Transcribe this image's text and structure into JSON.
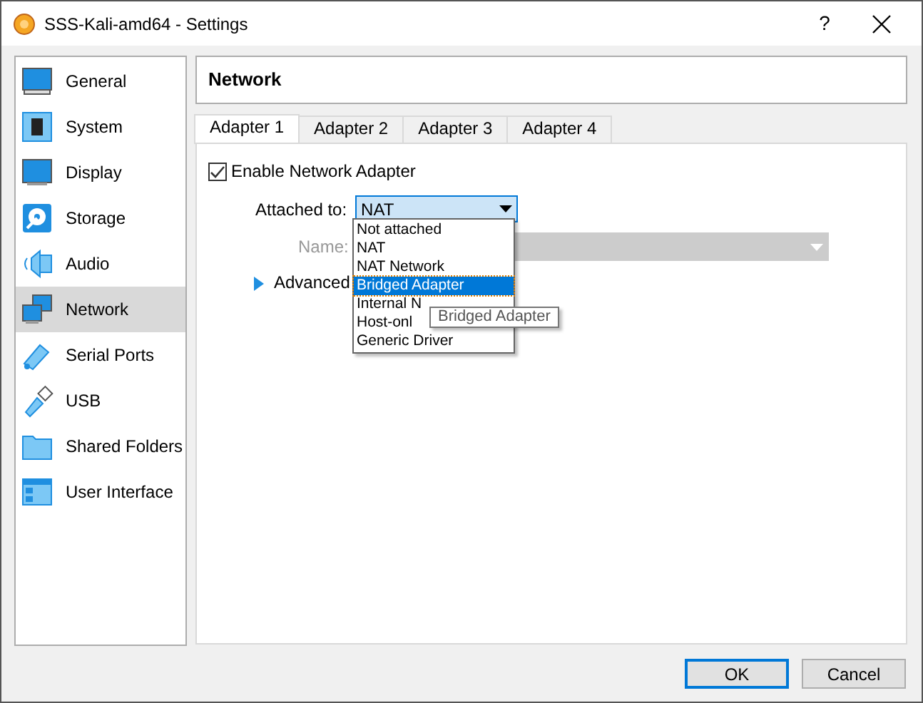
{
  "window": {
    "title": "SSS-Kali-amd64 - Settings",
    "help": "?"
  },
  "sidebar": {
    "items": [
      {
        "label": "General",
        "selected": false
      },
      {
        "label": "System",
        "selected": false
      },
      {
        "label": "Display",
        "selected": false
      },
      {
        "label": "Storage",
        "selected": false
      },
      {
        "label": "Audio",
        "selected": false
      },
      {
        "label": "Network",
        "selected": true
      },
      {
        "label": "Serial Ports",
        "selected": false
      },
      {
        "label": "USB",
        "selected": false
      },
      {
        "label": "Shared Folders",
        "selected": false
      },
      {
        "label": "User Interface",
        "selected": false
      }
    ]
  },
  "header": "Network",
  "tabs": [
    {
      "label": "Adapter 1",
      "selected": true
    },
    {
      "label": "Adapter 2",
      "selected": false
    },
    {
      "label": "Adapter 3",
      "selected": false
    },
    {
      "label": "Adapter 4",
      "selected": false
    }
  ],
  "enable_adapter": {
    "label": "Enable Network Adapter",
    "checked": true
  },
  "attached_to": {
    "label": "Attached to:",
    "value": "NAT",
    "expanded": true,
    "options": [
      {
        "label": "Not attached",
        "highlighted": false
      },
      {
        "label": "NAT",
        "highlighted": false
      },
      {
        "label": "NAT Network",
        "highlighted": false
      },
      {
        "label": "Bridged Adapter",
        "highlighted": true
      },
      {
        "label": "Internal N",
        "highlighted": false
      },
      {
        "label": "Host-onl",
        "highlighted": false
      },
      {
        "label": "Generic Driver",
        "highlighted": false
      }
    ]
  },
  "name": {
    "label": "Name:",
    "disabled": true
  },
  "advanced": {
    "label": "Advanced",
    "expanded": false
  },
  "tooltip": "Bridged Adapter",
  "buttons": [
    {
      "label": "OK",
      "default": true
    },
    {
      "label": "Cancel",
      "default": false
    }
  ]
}
